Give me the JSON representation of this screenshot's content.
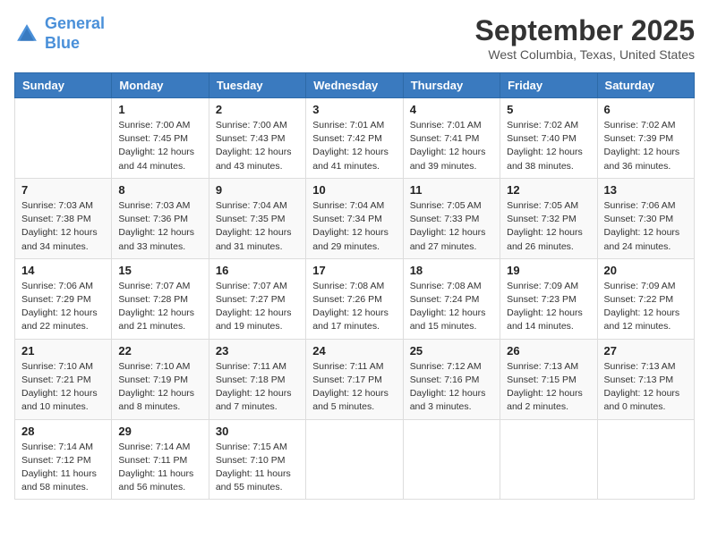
{
  "header": {
    "logo_line1": "General",
    "logo_line2": "Blue",
    "month_year": "September 2025",
    "location": "West Columbia, Texas, United States"
  },
  "days_of_week": [
    "Sunday",
    "Monday",
    "Tuesday",
    "Wednesday",
    "Thursday",
    "Friday",
    "Saturday"
  ],
  "weeks": [
    [
      {
        "day": "",
        "info": ""
      },
      {
        "day": "1",
        "info": "Sunrise: 7:00 AM\nSunset: 7:45 PM\nDaylight: 12 hours\nand 44 minutes."
      },
      {
        "day": "2",
        "info": "Sunrise: 7:00 AM\nSunset: 7:43 PM\nDaylight: 12 hours\nand 43 minutes."
      },
      {
        "day": "3",
        "info": "Sunrise: 7:01 AM\nSunset: 7:42 PM\nDaylight: 12 hours\nand 41 minutes."
      },
      {
        "day": "4",
        "info": "Sunrise: 7:01 AM\nSunset: 7:41 PM\nDaylight: 12 hours\nand 39 minutes."
      },
      {
        "day": "5",
        "info": "Sunrise: 7:02 AM\nSunset: 7:40 PM\nDaylight: 12 hours\nand 38 minutes."
      },
      {
        "day": "6",
        "info": "Sunrise: 7:02 AM\nSunset: 7:39 PM\nDaylight: 12 hours\nand 36 minutes."
      }
    ],
    [
      {
        "day": "7",
        "info": "Sunrise: 7:03 AM\nSunset: 7:38 PM\nDaylight: 12 hours\nand 34 minutes."
      },
      {
        "day": "8",
        "info": "Sunrise: 7:03 AM\nSunset: 7:36 PM\nDaylight: 12 hours\nand 33 minutes."
      },
      {
        "day": "9",
        "info": "Sunrise: 7:04 AM\nSunset: 7:35 PM\nDaylight: 12 hours\nand 31 minutes."
      },
      {
        "day": "10",
        "info": "Sunrise: 7:04 AM\nSunset: 7:34 PM\nDaylight: 12 hours\nand 29 minutes."
      },
      {
        "day": "11",
        "info": "Sunrise: 7:05 AM\nSunset: 7:33 PM\nDaylight: 12 hours\nand 27 minutes."
      },
      {
        "day": "12",
        "info": "Sunrise: 7:05 AM\nSunset: 7:32 PM\nDaylight: 12 hours\nand 26 minutes."
      },
      {
        "day": "13",
        "info": "Sunrise: 7:06 AM\nSunset: 7:30 PM\nDaylight: 12 hours\nand 24 minutes."
      }
    ],
    [
      {
        "day": "14",
        "info": "Sunrise: 7:06 AM\nSunset: 7:29 PM\nDaylight: 12 hours\nand 22 minutes."
      },
      {
        "day": "15",
        "info": "Sunrise: 7:07 AM\nSunset: 7:28 PM\nDaylight: 12 hours\nand 21 minutes."
      },
      {
        "day": "16",
        "info": "Sunrise: 7:07 AM\nSunset: 7:27 PM\nDaylight: 12 hours\nand 19 minutes."
      },
      {
        "day": "17",
        "info": "Sunrise: 7:08 AM\nSunset: 7:26 PM\nDaylight: 12 hours\nand 17 minutes."
      },
      {
        "day": "18",
        "info": "Sunrise: 7:08 AM\nSunset: 7:24 PM\nDaylight: 12 hours\nand 15 minutes."
      },
      {
        "day": "19",
        "info": "Sunrise: 7:09 AM\nSunset: 7:23 PM\nDaylight: 12 hours\nand 14 minutes."
      },
      {
        "day": "20",
        "info": "Sunrise: 7:09 AM\nSunset: 7:22 PM\nDaylight: 12 hours\nand 12 minutes."
      }
    ],
    [
      {
        "day": "21",
        "info": "Sunrise: 7:10 AM\nSunset: 7:21 PM\nDaylight: 12 hours\nand 10 minutes."
      },
      {
        "day": "22",
        "info": "Sunrise: 7:10 AM\nSunset: 7:19 PM\nDaylight: 12 hours\nand 8 minutes."
      },
      {
        "day": "23",
        "info": "Sunrise: 7:11 AM\nSunset: 7:18 PM\nDaylight: 12 hours\nand 7 minutes."
      },
      {
        "day": "24",
        "info": "Sunrise: 7:11 AM\nSunset: 7:17 PM\nDaylight: 12 hours\nand 5 minutes."
      },
      {
        "day": "25",
        "info": "Sunrise: 7:12 AM\nSunset: 7:16 PM\nDaylight: 12 hours\nand 3 minutes."
      },
      {
        "day": "26",
        "info": "Sunrise: 7:13 AM\nSunset: 7:15 PM\nDaylight: 12 hours\nand 2 minutes."
      },
      {
        "day": "27",
        "info": "Sunrise: 7:13 AM\nSunset: 7:13 PM\nDaylight: 12 hours\nand 0 minutes."
      }
    ],
    [
      {
        "day": "28",
        "info": "Sunrise: 7:14 AM\nSunset: 7:12 PM\nDaylight: 11 hours\nand 58 minutes."
      },
      {
        "day": "29",
        "info": "Sunrise: 7:14 AM\nSunset: 7:11 PM\nDaylight: 11 hours\nand 56 minutes."
      },
      {
        "day": "30",
        "info": "Sunrise: 7:15 AM\nSunset: 7:10 PM\nDaylight: 11 hours\nand 55 minutes."
      },
      {
        "day": "",
        "info": ""
      },
      {
        "day": "",
        "info": ""
      },
      {
        "day": "",
        "info": ""
      },
      {
        "day": "",
        "info": ""
      }
    ]
  ]
}
